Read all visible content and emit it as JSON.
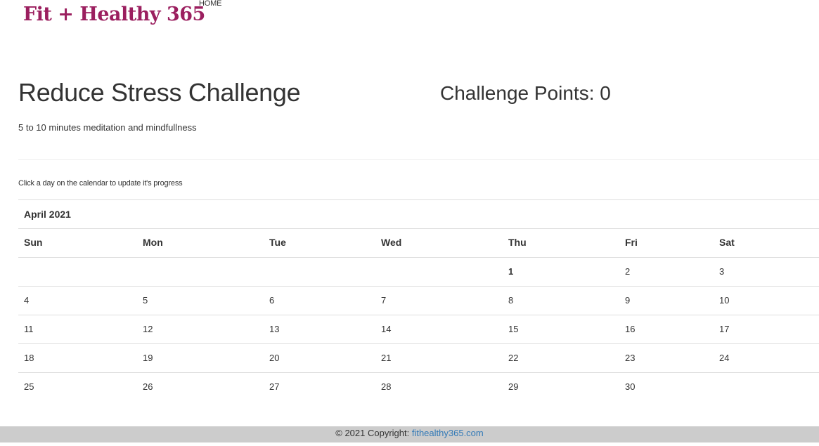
{
  "header": {
    "brand": "Fit + Healthy 365",
    "nav": {
      "home": "HOME"
    }
  },
  "challenge": {
    "title": "Reduce Stress Challenge",
    "points_label": "Challenge Points: 0",
    "points": 0,
    "description": "5 to 10 minutes meditation and mindfullness"
  },
  "instruction": "Click a day on the calendar to update it's progress",
  "calendar": {
    "month": "April 2021",
    "weekdays": [
      "Sun",
      "Mon",
      "Tue",
      "Wed",
      "Thu",
      "Fri",
      "Sat"
    ],
    "highlighted_day": "1",
    "weeks": [
      [
        "",
        "",
        "",
        "",
        "1",
        "2",
        "3"
      ],
      [
        "4",
        "5",
        "6",
        "7",
        "8",
        "9",
        "10"
      ],
      [
        "11",
        "12",
        "13",
        "14",
        "15",
        "16",
        "17"
      ],
      [
        "18",
        "19",
        "20",
        "21",
        "22",
        "23",
        "24"
      ],
      [
        "25",
        "26",
        "27",
        "28",
        "29",
        "30",
        ""
      ]
    ]
  },
  "footer": {
    "copyright": "© 2021 Copyright: ",
    "link": "fithealthy365.com"
  },
  "colors": {
    "brand": "#9b1f5f",
    "link": "#337ab7",
    "footer_bg": "#cccccc"
  }
}
